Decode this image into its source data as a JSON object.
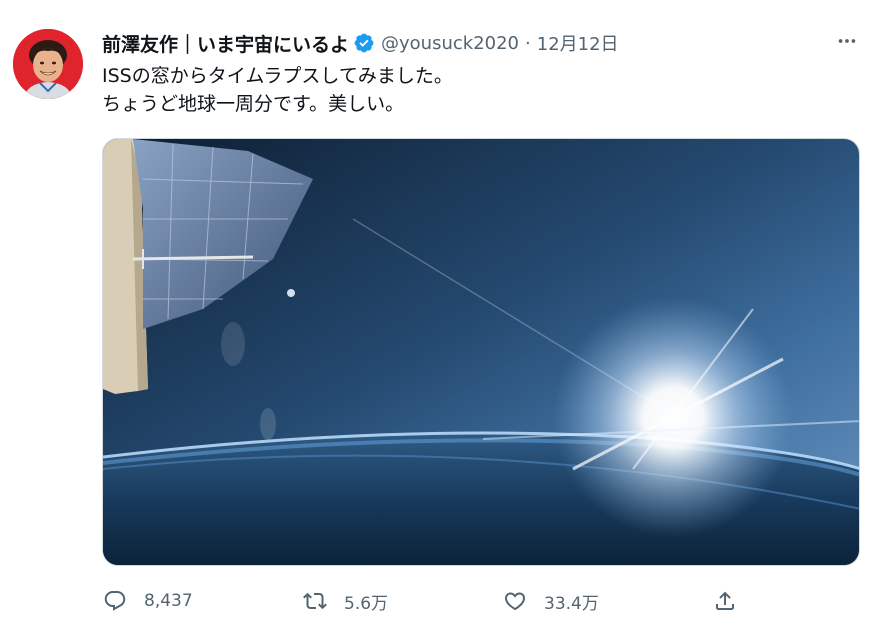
{
  "author": {
    "display_name": "前澤友作｜いま宇宙にいるよ",
    "handle": "@yousuck2020",
    "separator": "·",
    "date": "12月12日",
    "verified": true,
    "avatar_color": "#e0242e"
  },
  "tweet": {
    "text_line_1": "ISSの窓からタイムラプスしてみました。",
    "text_line_2": "ちょうど地球一周分です。美しい。"
  },
  "media": {
    "description_icon": "video-thumbnail"
  },
  "actions": {
    "reply_count": "8,437",
    "retweet_count": "5.6万",
    "like_count": "33.4万"
  },
  "colors": {
    "accent": "#1d9bf0",
    "secondary_text": "#536471",
    "primary_text": "#0f1419"
  },
  "icons": {
    "more": "more-horizontal-icon",
    "reply": "reply-icon",
    "retweet": "retweet-icon",
    "like": "heart-icon",
    "share": "share-icon",
    "verified": "verified-badge-icon"
  }
}
